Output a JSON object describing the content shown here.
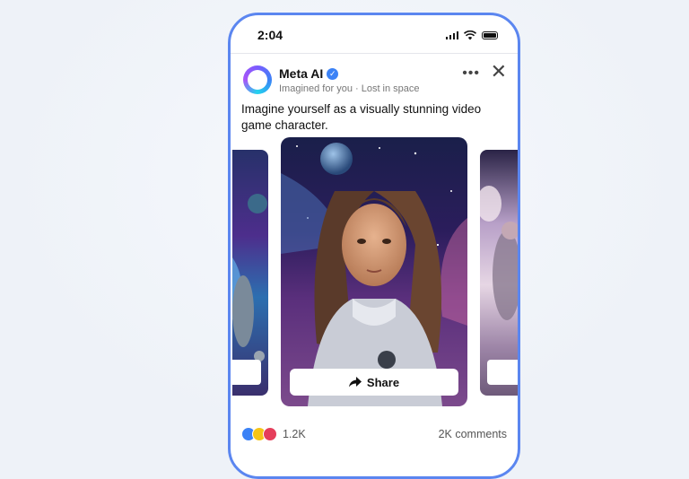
{
  "status_bar": {
    "time": "2:04"
  },
  "post": {
    "author": "Meta AI",
    "subtitle": "Imagined for you · Lost in space",
    "text": "Imagine yourself as a visually stunning video game character.",
    "share_label": "Share",
    "reaction_count": "1.2K",
    "comments": "2K comments"
  },
  "icons": [
    "signal-icon",
    "wifi-icon",
    "battery-icon",
    "verified-icon",
    "more-icon",
    "close-icon",
    "share-arrow-icon",
    "like-icon",
    "wow-icon",
    "love-icon"
  ],
  "colors": {
    "accent": "#5b86f0",
    "verified": "#3b82f6",
    "background": "#eef2f8"
  }
}
